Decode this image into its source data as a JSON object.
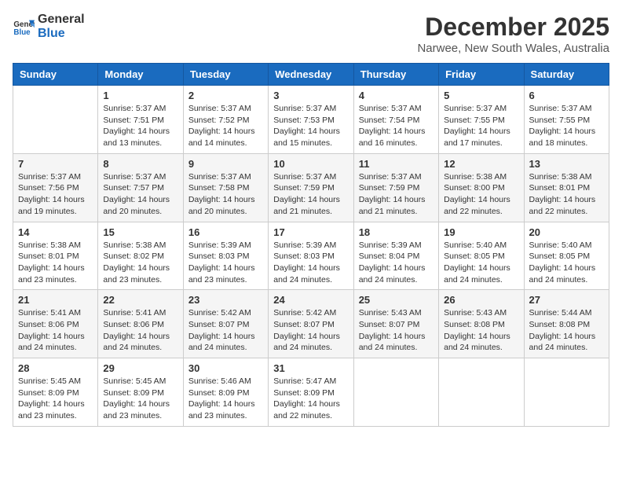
{
  "header": {
    "logo_general": "General",
    "logo_blue": "Blue",
    "month_title": "December 2025",
    "location": "Narwee, New South Wales, Australia"
  },
  "days_of_week": [
    "Sunday",
    "Monday",
    "Tuesday",
    "Wednesday",
    "Thursday",
    "Friday",
    "Saturday"
  ],
  "weeks": [
    [
      {
        "day": "",
        "info": ""
      },
      {
        "day": "1",
        "info": "Sunrise: 5:37 AM\nSunset: 7:51 PM\nDaylight: 14 hours\nand 13 minutes."
      },
      {
        "day": "2",
        "info": "Sunrise: 5:37 AM\nSunset: 7:52 PM\nDaylight: 14 hours\nand 14 minutes."
      },
      {
        "day": "3",
        "info": "Sunrise: 5:37 AM\nSunset: 7:53 PM\nDaylight: 14 hours\nand 15 minutes."
      },
      {
        "day": "4",
        "info": "Sunrise: 5:37 AM\nSunset: 7:54 PM\nDaylight: 14 hours\nand 16 minutes."
      },
      {
        "day": "5",
        "info": "Sunrise: 5:37 AM\nSunset: 7:55 PM\nDaylight: 14 hours\nand 17 minutes."
      },
      {
        "day": "6",
        "info": "Sunrise: 5:37 AM\nSunset: 7:55 PM\nDaylight: 14 hours\nand 18 minutes."
      }
    ],
    [
      {
        "day": "7",
        "info": "Sunrise: 5:37 AM\nSunset: 7:56 PM\nDaylight: 14 hours\nand 19 minutes."
      },
      {
        "day": "8",
        "info": "Sunrise: 5:37 AM\nSunset: 7:57 PM\nDaylight: 14 hours\nand 20 minutes."
      },
      {
        "day": "9",
        "info": "Sunrise: 5:37 AM\nSunset: 7:58 PM\nDaylight: 14 hours\nand 20 minutes."
      },
      {
        "day": "10",
        "info": "Sunrise: 5:37 AM\nSunset: 7:59 PM\nDaylight: 14 hours\nand 21 minutes."
      },
      {
        "day": "11",
        "info": "Sunrise: 5:37 AM\nSunset: 7:59 PM\nDaylight: 14 hours\nand 21 minutes."
      },
      {
        "day": "12",
        "info": "Sunrise: 5:38 AM\nSunset: 8:00 PM\nDaylight: 14 hours\nand 22 minutes."
      },
      {
        "day": "13",
        "info": "Sunrise: 5:38 AM\nSunset: 8:01 PM\nDaylight: 14 hours\nand 22 minutes."
      }
    ],
    [
      {
        "day": "14",
        "info": "Sunrise: 5:38 AM\nSunset: 8:01 PM\nDaylight: 14 hours\nand 23 minutes."
      },
      {
        "day": "15",
        "info": "Sunrise: 5:38 AM\nSunset: 8:02 PM\nDaylight: 14 hours\nand 23 minutes."
      },
      {
        "day": "16",
        "info": "Sunrise: 5:39 AM\nSunset: 8:03 PM\nDaylight: 14 hours\nand 23 minutes."
      },
      {
        "day": "17",
        "info": "Sunrise: 5:39 AM\nSunset: 8:03 PM\nDaylight: 14 hours\nand 24 minutes."
      },
      {
        "day": "18",
        "info": "Sunrise: 5:39 AM\nSunset: 8:04 PM\nDaylight: 14 hours\nand 24 minutes."
      },
      {
        "day": "19",
        "info": "Sunrise: 5:40 AM\nSunset: 8:05 PM\nDaylight: 14 hours\nand 24 minutes."
      },
      {
        "day": "20",
        "info": "Sunrise: 5:40 AM\nSunset: 8:05 PM\nDaylight: 14 hours\nand 24 minutes."
      }
    ],
    [
      {
        "day": "21",
        "info": "Sunrise: 5:41 AM\nSunset: 8:06 PM\nDaylight: 14 hours\nand 24 minutes."
      },
      {
        "day": "22",
        "info": "Sunrise: 5:41 AM\nSunset: 8:06 PM\nDaylight: 14 hours\nand 24 minutes."
      },
      {
        "day": "23",
        "info": "Sunrise: 5:42 AM\nSunset: 8:07 PM\nDaylight: 14 hours\nand 24 minutes."
      },
      {
        "day": "24",
        "info": "Sunrise: 5:42 AM\nSunset: 8:07 PM\nDaylight: 14 hours\nand 24 minutes."
      },
      {
        "day": "25",
        "info": "Sunrise: 5:43 AM\nSunset: 8:07 PM\nDaylight: 14 hours\nand 24 minutes."
      },
      {
        "day": "26",
        "info": "Sunrise: 5:43 AM\nSunset: 8:08 PM\nDaylight: 14 hours\nand 24 minutes."
      },
      {
        "day": "27",
        "info": "Sunrise: 5:44 AM\nSunset: 8:08 PM\nDaylight: 14 hours\nand 24 minutes."
      }
    ],
    [
      {
        "day": "28",
        "info": "Sunrise: 5:45 AM\nSunset: 8:09 PM\nDaylight: 14 hours\nand 23 minutes."
      },
      {
        "day": "29",
        "info": "Sunrise: 5:45 AM\nSunset: 8:09 PM\nDaylight: 14 hours\nand 23 minutes."
      },
      {
        "day": "30",
        "info": "Sunrise: 5:46 AM\nSunset: 8:09 PM\nDaylight: 14 hours\nand 23 minutes."
      },
      {
        "day": "31",
        "info": "Sunrise: 5:47 AM\nSunset: 8:09 PM\nDaylight: 14 hours\nand 22 minutes."
      },
      {
        "day": "",
        "info": ""
      },
      {
        "day": "",
        "info": ""
      },
      {
        "day": "",
        "info": ""
      }
    ]
  ]
}
